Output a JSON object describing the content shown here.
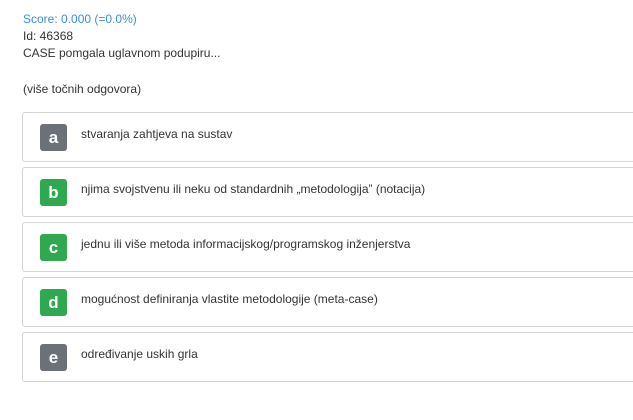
{
  "header": {
    "score": "Score: 0.000 (=0.0%)",
    "id": "Id: 46368",
    "question": "CASE pomgala uglavnom podupiru..."
  },
  "hint": "(više točnih odgovora)",
  "colors": {
    "score_text": "#3a8de0",
    "badge_neutral": "#6b7177",
    "badge_correct": "#2fa84f",
    "card_border": "#d4d4d4"
  },
  "answers": [
    {
      "letter": "a",
      "text": "stvaranja zahtjeva na sustav",
      "state": "neutral"
    },
    {
      "letter": "b",
      "text": "njima svojstvenu ili neku od standardnih „metodologija” (notacija)",
      "state": "correct"
    },
    {
      "letter": "c",
      "text": "jednu ili više metoda informacijskog/programskog inženjerstva",
      "state": "correct"
    },
    {
      "letter": "d",
      "text": "mogućnost definiranja vlastite metodologije (meta-case)",
      "state": "correct"
    },
    {
      "letter": "e",
      "text": "određivanje uskih grla",
      "state": "neutral"
    }
  ]
}
